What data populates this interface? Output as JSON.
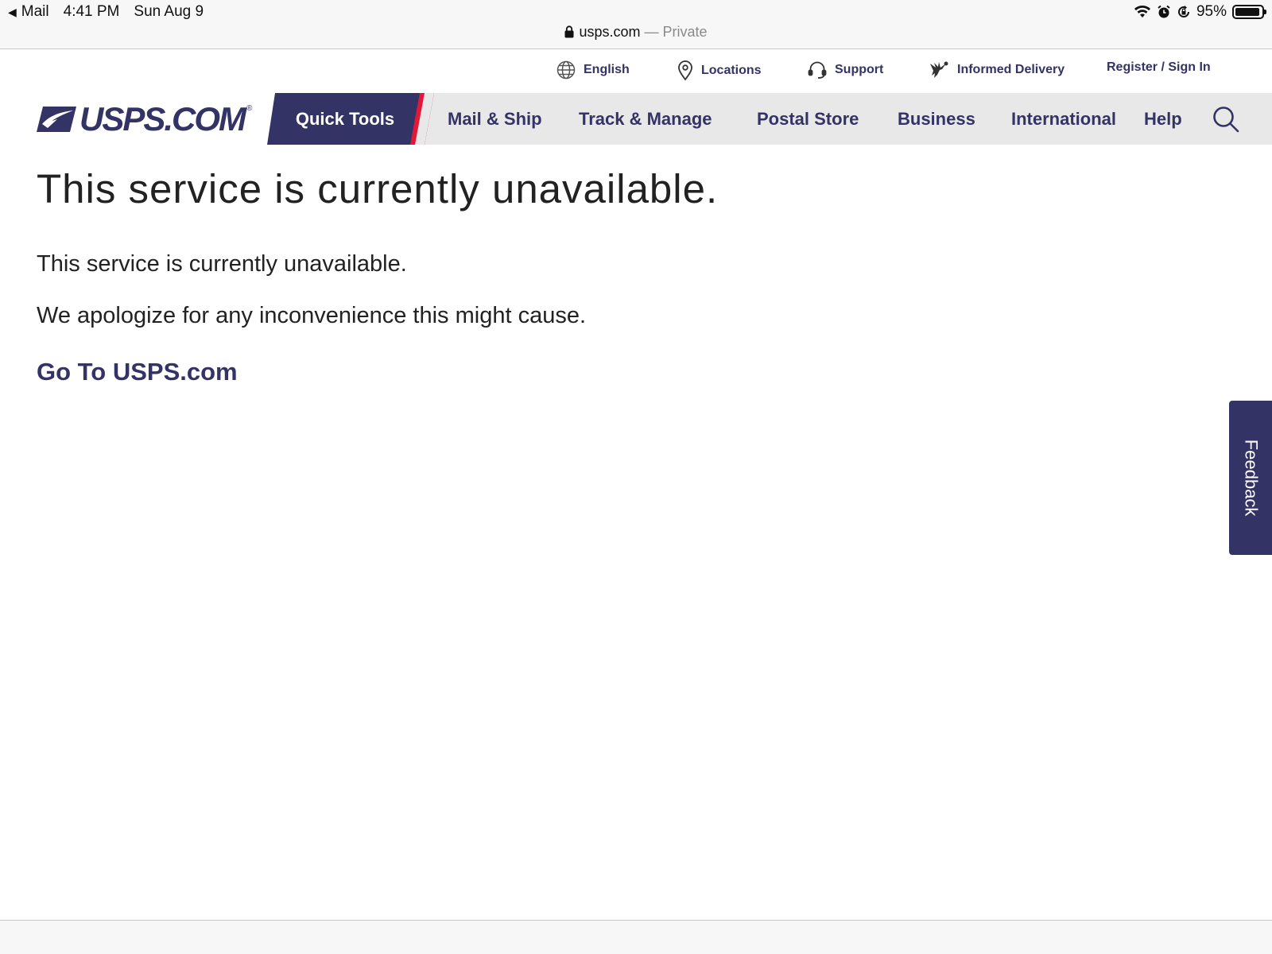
{
  "status_bar": {
    "back_app": "Mail",
    "time": "4:41 PM",
    "date": "Sun Aug 9",
    "battery": "95%",
    "battery_level": 0.95
  },
  "url_bar": {
    "domain": "usps.com",
    "mode": "— Private"
  },
  "utility_nav": {
    "language": "English",
    "locations": "Locations",
    "support": "Support",
    "informed_delivery": "Informed Delivery",
    "register": "Register / Sign In"
  },
  "main_nav": {
    "logo": "USPS.COM",
    "logo_mark": "®",
    "quick_tools": "Quick Tools",
    "items": [
      "Mail & Ship",
      "Track & Manage",
      "Postal Store",
      "Business",
      "International",
      "Help"
    ]
  },
  "content": {
    "title": "This service is currently unavailable.",
    "paragraph_1": "This service is currently unavailable.",
    "paragraph_2": "We apologize for any inconvenience this might cause.",
    "link": "Go To USPS.com"
  },
  "feedback_tab": "Feedback",
  "colors": {
    "brand_navy": "#333366",
    "brand_red": "#e31837",
    "nav_gray": "#e8e8e8"
  }
}
